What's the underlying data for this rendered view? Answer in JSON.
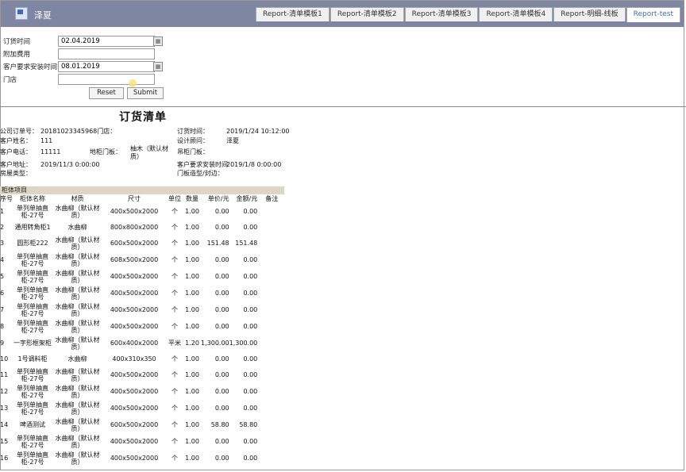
{
  "app": {
    "brand": "泽夏",
    "tabs": [
      "Report-清单模板1",
      "Report-清单模板2",
      "Report-清单模板3",
      "Report-清单模板4",
      "Report-明细-线板",
      "Report-test"
    ],
    "active_tab": 5
  },
  "form": {
    "order_time_label": "订货时间",
    "order_time_value": "02.04.2019",
    "extra_fee_label": "附加费用",
    "extra_fee_value": "",
    "install_time_label": "客户要求安装时间",
    "install_time_value": "08.01.2019",
    "store_label": "门店",
    "store_value": "",
    "reset_label": "Reset",
    "submit_label": "Submit"
  },
  "report": {
    "title": "订货清单",
    "company_order_label": "公司订单号：",
    "company_order_value": "20181023345968门店：",
    "order_time_label": "订货时间：",
    "order_time_value": "2019/1/24 10:12:00",
    "customer_name_label": "客户姓名：",
    "customer_name_value": "111",
    "designer_label": "设计顾问：",
    "designer_value": "泽夏",
    "customer_phone_label": "客户电话：",
    "customer_phone_value": "11111",
    "cabinet_door_label": "地柜门板：",
    "cabinet_door_value": "柚木（默认材质）",
    "hanging_door_label": "吊柜门板：",
    "customer_addr_label": "客户地址：",
    "customer_addr_value": "2019/11/3 0:00:00",
    "install_req_label": "客户要求安装时间",
    "install_req_value": "2019/1/8 0:00:00",
    "house_type_label": "房屋类型：",
    "door_model_label": "门板造型/封边：",
    "section_title": "柜体项目",
    "headers": [
      "序号",
      "柜体名称",
      "材质",
      "尺寸",
      "单位",
      "数量",
      "单价/元",
      "金额/元",
      "备注"
    ],
    "rows": [
      [
        "1",
        "单列单抽直柜-27号",
        "水曲柳（默认材质）",
        "400x500x2000",
        "个",
        "1.00",
        "0.00",
        "0.00",
        ""
      ],
      [
        "2",
        "通用转角柜1",
        "水曲柳",
        "800x800x2000",
        "个",
        "1.00",
        "0.00",
        "0.00",
        ""
      ],
      [
        "3",
        "圆形柜222",
        "水曲柳（默认材质）",
        "600x500x2000",
        "个",
        "1.00",
        "151.48",
        "151.48",
        ""
      ],
      [
        "4",
        "单列单抽直柜-27号",
        "水曲柳（默认材质）",
        "608x500x2000",
        "个",
        "1.00",
        "0.00",
        "0.00",
        ""
      ],
      [
        "5",
        "单列单抽直柜-27号",
        "水曲柳（默认材质）",
        "400x500x2000",
        "个",
        "1.00",
        "0.00",
        "0.00",
        ""
      ],
      [
        "6",
        "单列单抽直柜-27号",
        "水曲柳（默认材质）",
        "400x500x2000",
        "个",
        "1.00",
        "0.00",
        "0.00",
        ""
      ],
      [
        "7",
        "单列单抽直柜-27号",
        "水曲柳（默认材质）",
        "400x500x2000",
        "个",
        "1.00",
        "0.00",
        "0.00",
        ""
      ],
      [
        "8",
        "单列单抽直柜-27号",
        "水曲柳（默认材质）",
        "400x500x2000",
        "个",
        "1.00",
        "0.00",
        "0.00",
        ""
      ],
      [
        "9",
        "一字形框架柜",
        "水曲柳（默认材质）",
        "600x400x2000",
        "平米",
        "1.20",
        "1,300.00",
        "1,300.00",
        ""
      ],
      [
        "10",
        "1号调料柜",
        "水曲柳",
        "400x310x350",
        "个",
        "1.00",
        "0.00",
        "0.00",
        ""
      ],
      [
        "11",
        "单列单抽直柜-27号",
        "水曲柳（默认材质）",
        "400x500x2000",
        "个",
        "1.00",
        "0.00",
        "0.00",
        ""
      ],
      [
        "12",
        "单列单抽直柜-27号",
        "水曲柳（默认材质）",
        "400x500x2000",
        "个",
        "1.00",
        "0.00",
        "0.00",
        ""
      ],
      [
        "13",
        "单列单抽直柜-27号",
        "水曲柳（默认材质）",
        "400x500x2000",
        "个",
        "1.00",
        "0.00",
        "0.00",
        ""
      ],
      [
        "14",
        "啤酒测试",
        "水曲柳（默认材质）",
        "600x500x2000",
        "个",
        "1.00",
        "58.80",
        "58.80",
        ""
      ],
      [
        "15",
        "单列单抽直柜-27号",
        "水曲柳（默认材质）",
        "400x500x2000",
        "个",
        "1.00",
        "0.00",
        "0.00",
        ""
      ],
      [
        "16",
        "单列单抽直柜-27号",
        "水曲柳（默认材质）",
        "400x500x2000",
        "个",
        "1.00",
        "0.00",
        "0.00",
        ""
      ]
    ]
  }
}
